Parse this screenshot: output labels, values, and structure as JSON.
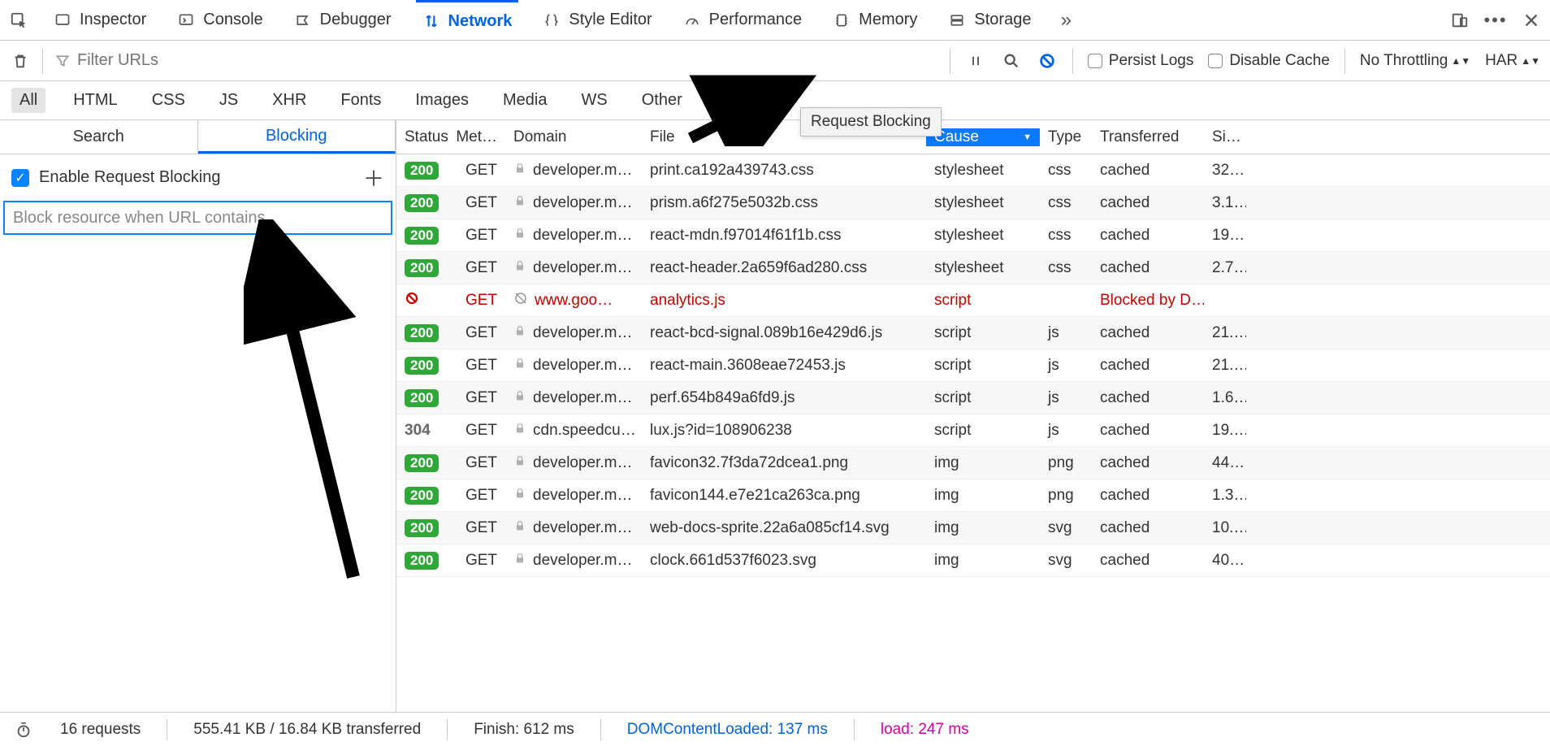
{
  "tabs": {
    "inspector": "Inspector",
    "console": "Console",
    "debugger": "Debugger",
    "network": "Network",
    "style_editor": "Style Editor",
    "performance": "Performance",
    "memory": "Memory",
    "storage": "Storage"
  },
  "toolbar": {
    "filter_placeholder": "Filter URLs",
    "persist": "Persist Logs",
    "disable_cache": "Disable Cache",
    "throttling": "No Throttling",
    "har": "HAR"
  },
  "filter_tabs": {
    "all": "All",
    "html": "HTML",
    "css": "CSS",
    "js": "JS",
    "xhr": "XHR",
    "fonts": "Fonts",
    "images": "Images",
    "media": "Media",
    "ws": "WS",
    "other": "Other"
  },
  "left": {
    "search": "Search",
    "blocking": "Blocking",
    "enable_label": "Enable Request Blocking",
    "input_placeholder": "Block resource when URL contains"
  },
  "columns": {
    "status": "Status",
    "method": "Met…",
    "domain": "Domain",
    "file": "File",
    "cause": "Cause",
    "type": "Type",
    "transferred": "Transferred",
    "size": "Si…"
  },
  "rows": [
    {
      "status": "200",
      "method": "GET",
      "domain": "developer.m…",
      "file": "print.ca192a439743.css",
      "cause": "stylesheet",
      "type": "css",
      "transferred": "cached",
      "size": "32…",
      "lock": true
    },
    {
      "status": "200",
      "method": "GET",
      "domain": "developer.m…",
      "file": "prism.a6f275e5032b.css",
      "cause": "stylesheet",
      "type": "css",
      "transferred": "cached",
      "size": "3.1…",
      "lock": true
    },
    {
      "status": "200",
      "method": "GET",
      "domain": "developer.m…",
      "file": "react-mdn.f97014f61f1b.css",
      "cause": "stylesheet",
      "type": "css",
      "transferred": "cached",
      "size": "19…",
      "lock": true
    },
    {
      "status": "200",
      "method": "GET",
      "domain": "developer.m…",
      "file": "react-header.2a659f6ad280.css",
      "cause": "stylesheet",
      "type": "css",
      "transferred": "cached",
      "size": "2.7…",
      "lock": true
    },
    {
      "status": "blocked",
      "method": "GET",
      "domain": "www.goo…",
      "file": "analytics.js",
      "cause": "script",
      "type": "",
      "transferred": "Blocked by D…",
      "size": ""
    },
    {
      "status": "200",
      "method": "GET",
      "domain": "developer.m…",
      "file": "react-bcd-signal.089b16e429d6.js",
      "cause": "script",
      "type": "js",
      "transferred": "cached",
      "size": "21.…",
      "lock": true
    },
    {
      "status": "200",
      "method": "GET",
      "domain": "developer.m…",
      "file": "react-main.3608eae72453.js",
      "cause": "script",
      "type": "js",
      "transferred": "cached",
      "size": "21.…",
      "lock": true
    },
    {
      "status": "200",
      "method": "GET",
      "domain": "developer.m…",
      "file": "perf.654b849a6fd9.js",
      "cause": "script",
      "type": "js",
      "transferred": "cached",
      "size": "1.6…",
      "lock": true
    },
    {
      "status": "304",
      "method": "GET",
      "domain": "cdn.speedcu…",
      "file": "lux.js?id=108906238",
      "cause": "script",
      "type": "js",
      "transferred": "cached",
      "size": "19.…",
      "lock": true
    },
    {
      "status": "200",
      "method": "GET",
      "domain": "developer.m…",
      "file": "favicon32.7f3da72dcea1.png",
      "cause": "img",
      "type": "png",
      "transferred": "cached",
      "size": "44…",
      "lock": true
    },
    {
      "status": "200",
      "method": "GET",
      "domain": "developer.m…",
      "file": "favicon144.e7e21ca263ca.png",
      "cause": "img",
      "type": "png",
      "transferred": "cached",
      "size": "1.3…",
      "lock": true
    },
    {
      "status": "200",
      "method": "GET",
      "domain": "developer.m…",
      "file": "web-docs-sprite.22a6a085cf14.svg",
      "cause": "img",
      "type": "svg",
      "transferred": "cached",
      "size": "10.…",
      "lock": true
    },
    {
      "status": "200",
      "method": "GET",
      "domain": "developer.m…",
      "file": "clock.661d537f6023.svg",
      "cause": "img",
      "type": "svg",
      "transferred": "cached",
      "size": "40…",
      "lock": true
    }
  ],
  "status_bar": {
    "requests": "16 requests",
    "transferred": "555.41 KB / 16.84 KB transferred",
    "finish": "Finish: 612 ms",
    "dcl": "DOMContentLoaded: 137 ms",
    "load": "load: 247 ms"
  },
  "tooltip": "Request Blocking"
}
